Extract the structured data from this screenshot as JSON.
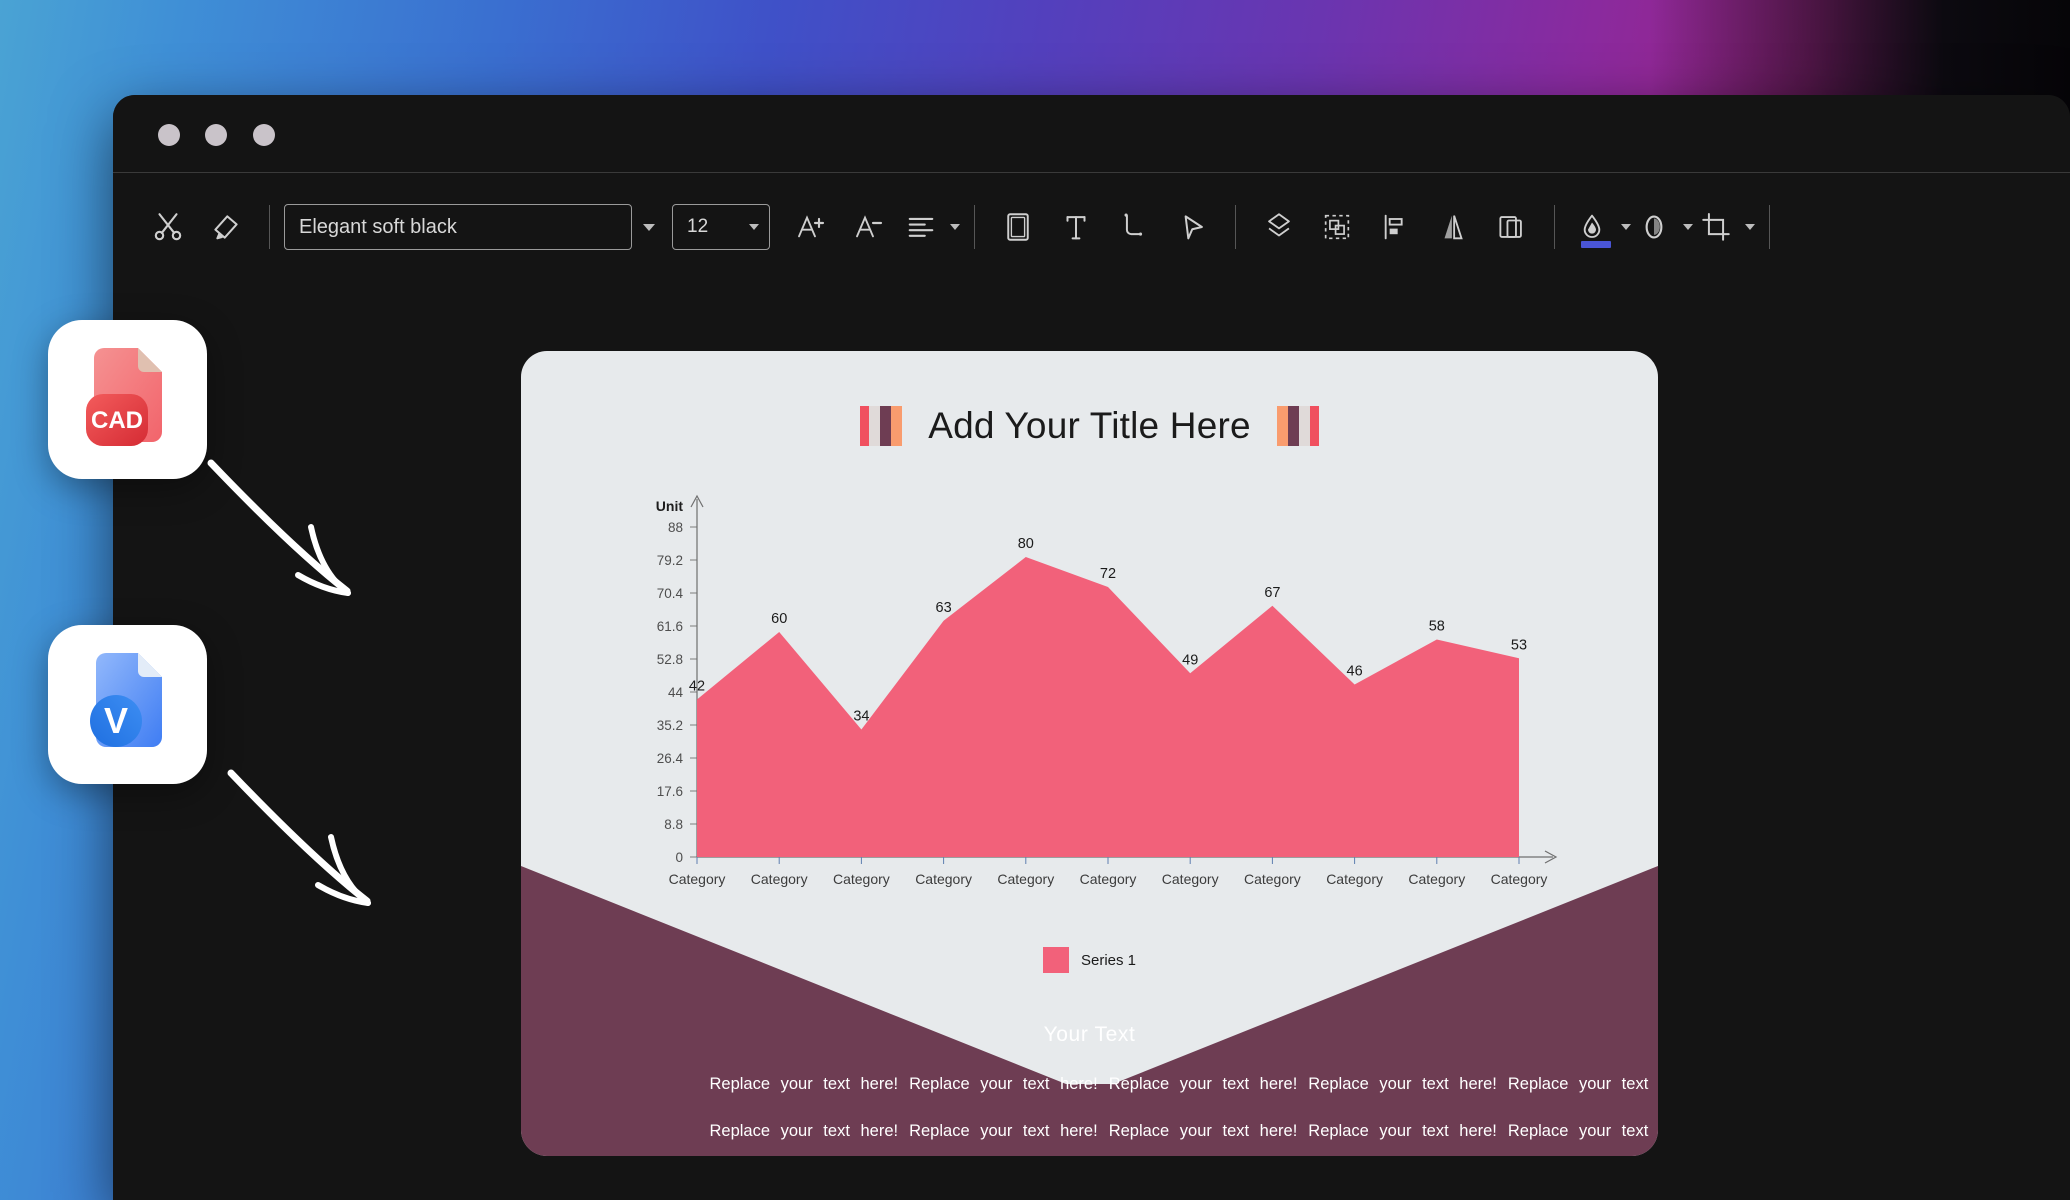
{
  "window": {
    "traffic_lights": [
      "close",
      "minimize",
      "maximize"
    ]
  },
  "toolbar": {
    "cut_label": "Cut",
    "format_painter_label": "Format Painter",
    "font_name": "Elegant soft black",
    "font_size": "12",
    "grow_font_label": "Increase Font Size",
    "shrink_font_label": "Decrease Font Size",
    "align_label": "Paragraph Alignment",
    "shape_label": "Shape",
    "text_box_label": "Text Box",
    "connector_label": "Connector",
    "pointer_label": "Pointer",
    "layers_label": "Layers",
    "group_label": "Group",
    "align_objects_label": "Align Objects",
    "flip_label": "Flip",
    "duplicate_label": "Duplicate",
    "fill_label": "Fill Color",
    "outline_label": "Line Color",
    "crop_label": "Crop",
    "fill_accent_color": "#4a55d6"
  },
  "slide": {
    "title": "Add Your Title Here",
    "background_color": "#e7eaec",
    "envelope_color": "#6e3d53",
    "accent_color": "#f2617a",
    "bottom_heading": "Your Text",
    "paragraph_chunks": [
      "Replace your text here!",
      "Replace your text here!",
      "Replace your text here!",
      "Replace your text here!",
      "Replace your text here!"
    ],
    "paragraphs": 2,
    "title_stripe_colors": [
      "#f0505f",
      "#e0dad9",
      "#6e3d53",
      "#f99c6e"
    ]
  },
  "chart_data": {
    "type": "area",
    "title": "Add Your Title Here",
    "ylabel": "Unit",
    "xlabel": "",
    "categories": [
      "Category",
      "Category",
      "Category",
      "Category",
      "Category",
      "Category",
      "Category",
      "Category",
      "Category",
      "Category",
      "Category"
    ],
    "series": [
      {
        "name": "Series 1",
        "color": "#f2617a",
        "values": [
          42,
          60,
          34,
          63,
          80,
          72,
          49,
          67,
          46,
          58,
          53
        ]
      }
    ],
    "values": [
      42,
      60,
      34,
      63,
      80,
      72,
      49,
      67,
      46,
      58,
      53
    ],
    "yticks": [
      0,
      8.8,
      17.6,
      26.4,
      35.2,
      44,
      52.8,
      61.6,
      70.4,
      79.2,
      88
    ],
    "ytick_labels": [
      "0",
      "8.8",
      "17.6",
      "26.4",
      "35.2",
      "44",
      "52.8",
      "61.6",
      "70.4",
      "79.2",
      "88"
    ],
    "ylim": [
      0,
      88
    ],
    "grid": false,
    "legend": {
      "position": "bottom",
      "entries": [
        "Series 1"
      ]
    },
    "data_labels": true
  },
  "files": [
    {
      "name": "CAD",
      "badge": "CAD",
      "color": "#e8454a"
    },
    {
      "name": "Visio",
      "badge": "V",
      "color": "#2f7df0"
    }
  ],
  "annotations": [
    {
      "name": "arrow-to-slide-1"
    },
    {
      "name": "arrow-to-slide-2"
    }
  ]
}
